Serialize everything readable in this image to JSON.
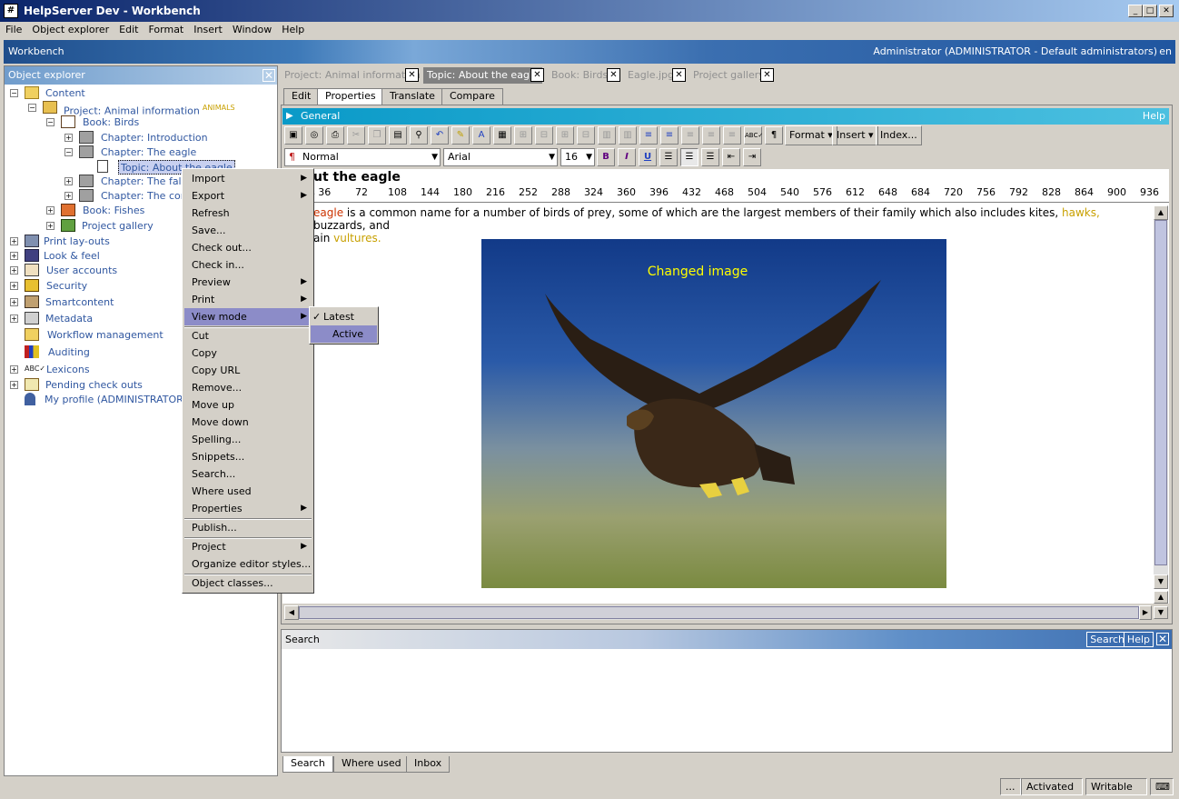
{
  "window": {
    "title": "HelpServer Dev - Workbench",
    "app_icon": "hash-icon"
  },
  "menubar": [
    "File",
    "Object explorer",
    "Edit",
    "Format",
    "Insert",
    "Window",
    "Help"
  ],
  "workbench": {
    "label": "Workbench",
    "user": "Administrator (ADMINISTRATOR - Default administrators)",
    "lang": "en"
  },
  "object_explorer": {
    "title": "Object explorer",
    "tree": [
      {
        "label": "Content"
      },
      {
        "label": "Project: Animal information",
        "badge": "ANIMALS"
      },
      {
        "label": "Book: Birds"
      },
      {
        "label": "Chapter: Introduction"
      },
      {
        "label": "Chapter: The eagle"
      },
      {
        "label": "Topic: About the eagle"
      },
      {
        "label": "Chapter: The falco"
      },
      {
        "label": "Chapter: The cond"
      },
      {
        "label": "Book: Fishes"
      },
      {
        "label": "Project gallery"
      },
      {
        "label": "Print lay-outs"
      },
      {
        "label": "Look & feel"
      },
      {
        "label": "User accounts"
      },
      {
        "label": "Security"
      },
      {
        "label": "Smartcontent"
      },
      {
        "label": "Metadata"
      },
      {
        "label": "Workflow management"
      },
      {
        "label": "Auditing"
      },
      {
        "label": "Lexicons"
      },
      {
        "label": "Pending check outs"
      },
      {
        "label": "My profile (ADMINISTRATOR)"
      }
    ]
  },
  "doc_tabs": [
    "Project: Animal information",
    "Topic: About the eagle",
    "Book: Birds",
    "Eagle.jpg",
    "Project gallery"
  ],
  "sub_tabs": [
    "Edit",
    "Properties",
    "Translate",
    "Compare"
  ],
  "general": {
    "label": "General",
    "help": "Help"
  },
  "toolbar": {
    "format": "Format",
    "insert": "Insert",
    "index": "Index..."
  },
  "formatbar": {
    "style": "Normal",
    "font": "Arial",
    "size": "16",
    "bold": "B",
    "italic": "I",
    "underline": "U"
  },
  "document": {
    "heading": "ut the eagle",
    "ruler": [
      "s 36",
      "72",
      "108",
      "144",
      "180",
      "216",
      "252",
      "288",
      "324",
      "360",
      "396",
      "432",
      "468",
      "504",
      "540",
      "576",
      "612",
      "648",
      "684",
      "720",
      "756",
      "792",
      "828",
      "864",
      "900",
      "936"
    ],
    "p1_link": "eagle",
    "p1_text": " is a common name for a number of birds of prey, some of which are the largest members of their family which also includes kites, ",
    "p1_hawks": "hawks,",
    "p1_rest": " buzzards, and",
    "p2_pre": "ain ",
    "p2_link": "vultures.",
    "image_caption": "Changed image"
  },
  "context_menu": [
    "Import",
    "Export",
    "Refresh",
    "Save...",
    "Check out...",
    "Check in...",
    "Preview",
    "Print",
    "View mode",
    "Cut",
    "Copy",
    "Copy URL",
    "Remove...",
    "Move up",
    "Move down",
    "Spelling...",
    "Snippets...",
    "Search...",
    "Where used",
    "Properties",
    "Publish...",
    "Project",
    "Organize editor styles...",
    "Object classes..."
  ],
  "submenu": [
    "Latest",
    "Active"
  ],
  "search_panel": {
    "title": "Search",
    "search_btn": "Search",
    "help_btn": "Help"
  },
  "bottom_tabs": [
    "Search",
    "Where used",
    "Inbox"
  ],
  "status": {
    "dots": "...",
    "activated": "Activated",
    "writable": "Writable"
  },
  "colors": {
    "link_red": "#cc3300",
    "link_gold": "#c8a000",
    "caption": "#ffff00",
    "tree_text": "#3057a0"
  }
}
